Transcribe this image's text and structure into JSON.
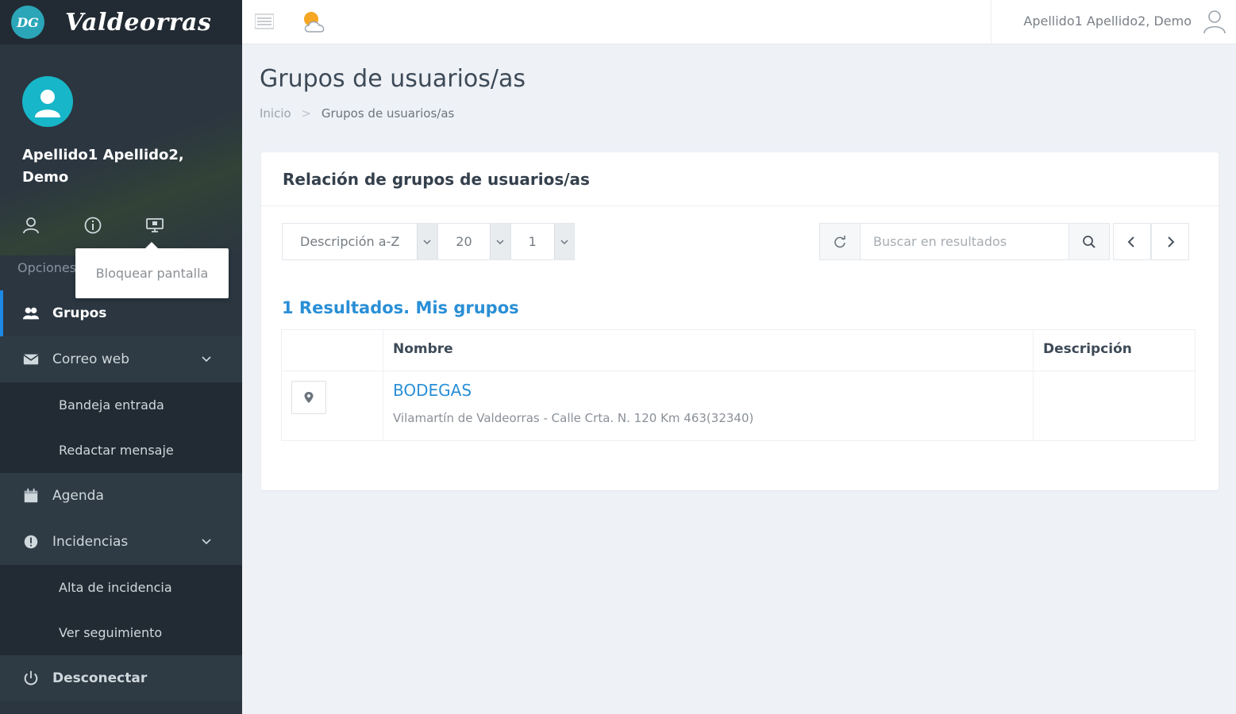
{
  "brand": {
    "logo_text": "DG",
    "name": "Valdeorras"
  },
  "profile": {
    "name": "Apellido1 Apellido2, Demo"
  },
  "options_label": "Opciones",
  "tooltip": {
    "text": "Bloquear pantalla"
  },
  "nav": {
    "grupos": "Grupos",
    "correo_web": "Correo web",
    "bandeja_entrada": "Bandeja entrada",
    "redactar_mensaje": "Redactar mensaje",
    "agenda": "Agenda",
    "incidencias": "Incidencias",
    "alta_incidencia": "Alta de incidencia",
    "ver_seguimiento": "Ver seguimiento",
    "desconectar": "Desconectar"
  },
  "topbar": {
    "user_name": "Apellido1 Apellido2, Demo"
  },
  "page": {
    "title": "Grupos de usuarios/as",
    "breadcrumb": {
      "home": "Inicio",
      "separator": ">",
      "current": "Grupos de usuarios/as"
    }
  },
  "panel": {
    "title": "Relación de grupos de usuarios/as",
    "sort_select": "Descripción a-Z",
    "page_size_select": "20",
    "page_select": "1",
    "search_placeholder": "Buscar en resultados",
    "results_text": "1 Resultados. Mis grupos",
    "table": {
      "headers": {
        "icon": "",
        "nombre": "Nombre",
        "descripcion": "Descripción"
      },
      "rows": [
        {
          "nombre": "BODEGAS",
          "direccion": "Vilamartín de Valdeorras - Calle Crta. N. 120 Km 463(32340)",
          "descripcion": ""
        }
      ]
    }
  },
  "colors": {
    "sidebar": "#2b3640",
    "accent": "#2a8fd6",
    "avatar": "#17b6c8"
  }
}
